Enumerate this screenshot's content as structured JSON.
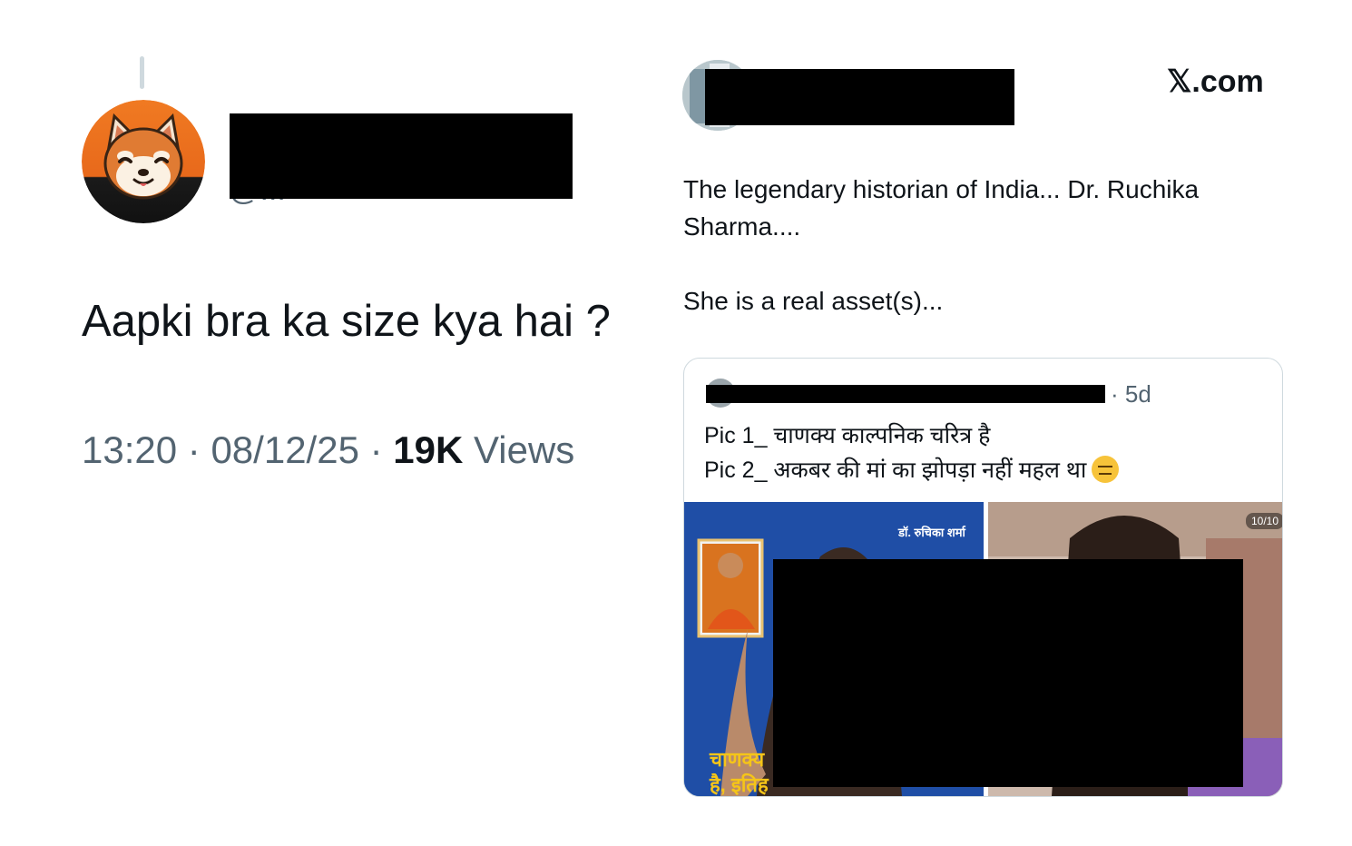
{
  "left_tweet": {
    "handle_partial": "@...",
    "text": "Aapki bra ka size kya hai ?",
    "time": "13:20",
    "date": "08/12/25",
    "views_count": "19K",
    "views_label": "Views",
    "separator": "·"
  },
  "right_tweet": {
    "brand": "𝕏.com",
    "lines": [
      "The legendary historian of India... Dr. Ruchika",
      "Sharma....",
      "She is a real asset(s)..."
    ],
    "quote": {
      "time": "· 5d",
      "lines": [
        "Pic 1_ चाणक्य काल्पनिक चरित्र है",
        "Pic 2_ अकबर की मां का झोपड़ा नहीं महल था"
      ],
      "emoji": "expressionless-face",
      "media_left": {
        "source_label": "डॉ. रुचिका शर्मा",
        "caption_1": "चाणक्य",
        "caption_2": "है, इतिह"
      },
      "media_right": {
        "counter": "10/10"
      }
    }
  },
  "colors": {
    "text": "#0f1419",
    "muted": "#536471",
    "border": "#cfd9de",
    "media_blue": "#1f4ea6",
    "caption_yellow": "#f5c518",
    "avatar_orange": "#f07a22"
  }
}
